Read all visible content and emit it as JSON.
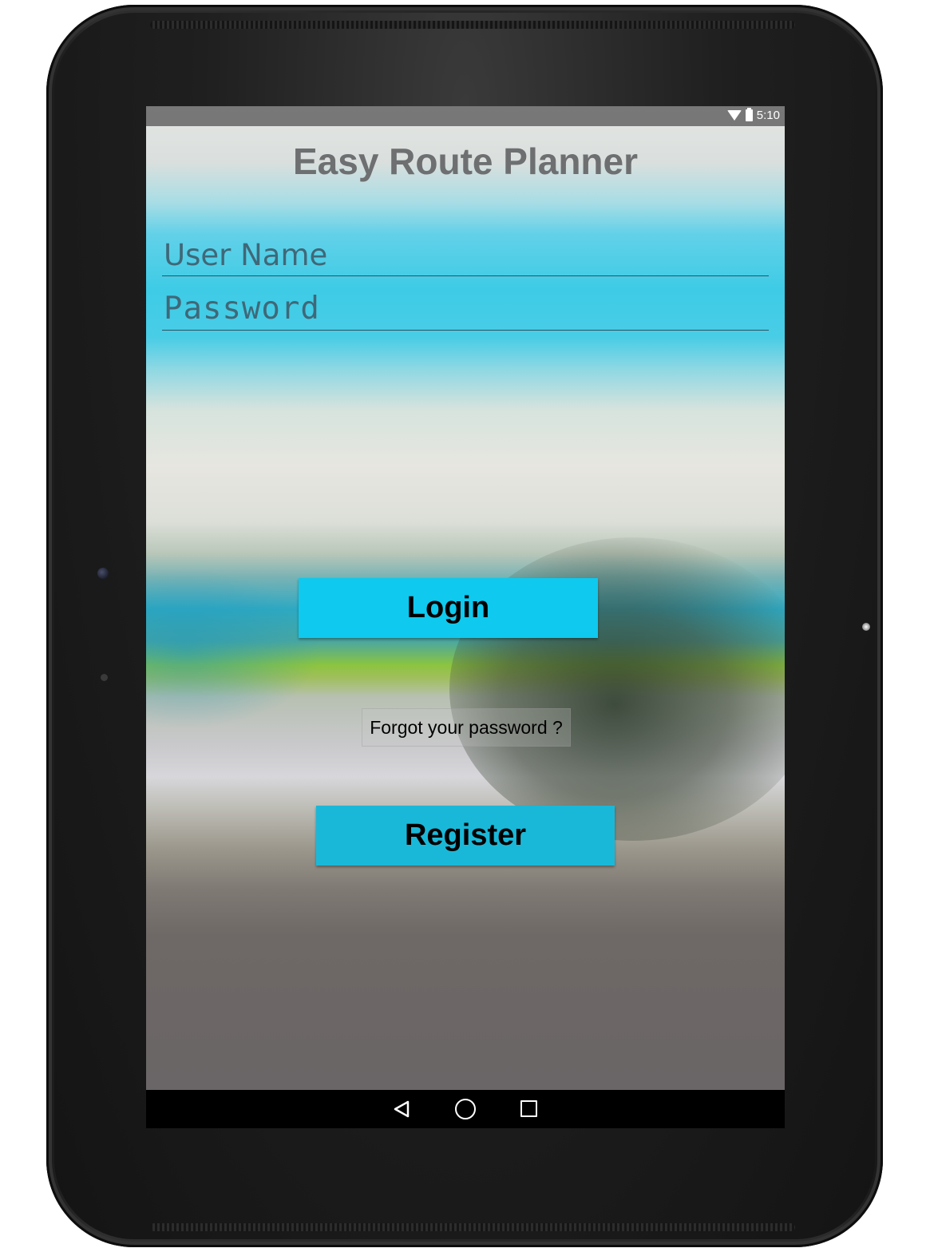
{
  "status_bar": {
    "time": "5:10",
    "icons": [
      "wifi-icon",
      "battery-icon"
    ]
  },
  "app": {
    "title": "Easy Route Planner"
  },
  "form": {
    "username_placeholder": "User Name",
    "password_placeholder": "Password",
    "login_label": "Login",
    "forgot_label": "Forgot your password ?",
    "register_label": "Register"
  },
  "nav_bar": {
    "icons": [
      "back-icon",
      "home-icon",
      "recent-apps-icon"
    ]
  },
  "colors": {
    "login_button": "#0fc9ee",
    "register_button": "#1ab8d8",
    "title_text": "#6d6f70"
  }
}
